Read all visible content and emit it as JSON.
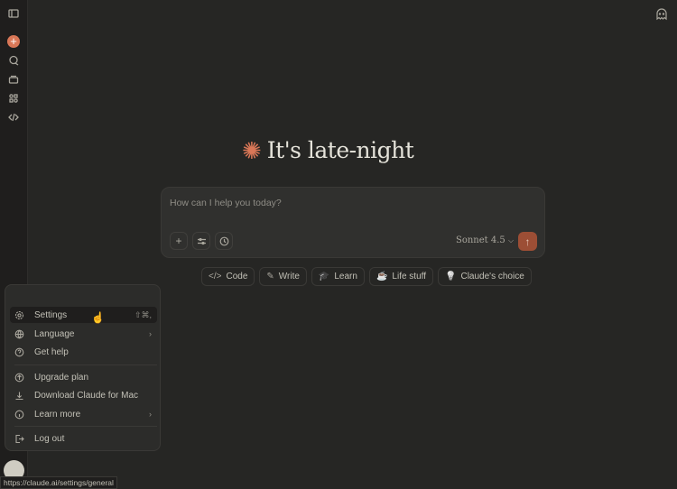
{
  "sidebar": {
    "items": [
      "toggle-sidebar",
      "new-chat",
      "chats",
      "projects",
      "artifacts",
      "code"
    ]
  },
  "greeting": "It's late-night",
  "composer": {
    "placeholder": "How can I help you today?",
    "model": "Sonnet 4.5"
  },
  "chips": [
    {
      "label": "Code",
      "icon": "</>"
    },
    {
      "label": "Write",
      "icon": "✎"
    },
    {
      "label": "Learn",
      "icon": "🎓"
    },
    {
      "label": "Life stuff",
      "icon": "☕"
    },
    {
      "label": "Claude's choice",
      "icon": "💡"
    }
  ],
  "menu": {
    "settings": "Settings",
    "settings_shortcut": "⇧⌘,",
    "language": "Language",
    "get_help": "Get help",
    "upgrade": "Upgrade plan",
    "download": "Download Claude for Mac",
    "learn_more": "Learn more",
    "logout": "Log out"
  },
  "status_url": "https://claude.ai/settings/general",
  "colors": {
    "accent": "#d97757",
    "background": "#262624"
  }
}
